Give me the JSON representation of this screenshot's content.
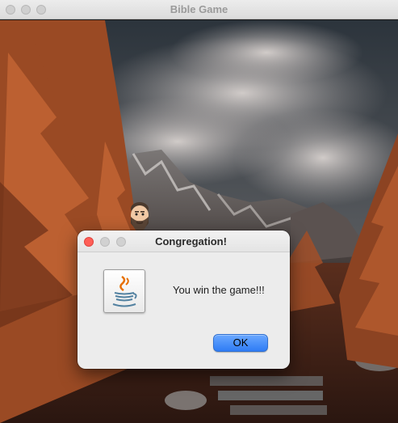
{
  "window": {
    "title": "Bible Game"
  },
  "dialog": {
    "title": "Congregation!",
    "message": "You win the game!!!",
    "ok_label": "OK",
    "icon": "java-cup-icon"
  },
  "player": {
    "icon": "bearded-man-avatar-icon"
  },
  "colors": {
    "ok_button": "#2f7cf5",
    "close_dot": "#ff5f57",
    "dialog_bg": "#ececec"
  }
}
